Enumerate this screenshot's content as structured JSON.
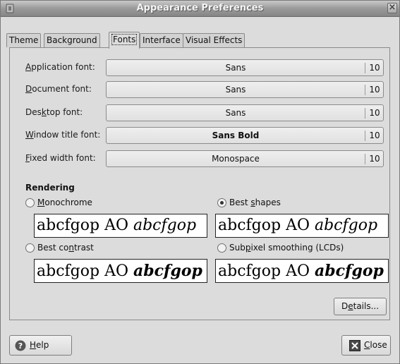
{
  "window": {
    "title": "Appearance Preferences",
    "close_glyph": "×"
  },
  "tabs": [
    {
      "label": "Theme",
      "active": false
    },
    {
      "label": "Background",
      "active": false
    },
    {
      "label": "Fonts",
      "active": true
    },
    {
      "label": "Interface",
      "active": false
    },
    {
      "label": "Visual Effects",
      "active": false
    }
  ],
  "fonts": [
    {
      "label": "Application font:",
      "mnemonic": "A",
      "font": "Sans",
      "size": "10"
    },
    {
      "label": "Document font:",
      "mnemonic": "D",
      "font": "Sans",
      "size": "10"
    },
    {
      "label": "Desktop font:",
      "mnemonic": "k",
      "font": "Sans",
      "size": "10"
    },
    {
      "label": "Window title font:",
      "mnemonic": "W",
      "font": "Sans Bold",
      "size": "10"
    },
    {
      "label": "Fixed width font:",
      "mnemonic": "F",
      "font": "Monospace",
      "size": "10"
    }
  ],
  "rendering": {
    "title": "Rendering",
    "options": [
      {
        "label": "Monochrome",
        "selected": false,
        "sample": {
          "plain": "abcfgop AO ",
          "styled": "abcfgop"
        }
      },
      {
        "label": "Best shapes",
        "selected": true,
        "sample": {
          "plain": "abcfgop AO ",
          "styled": "abcfgop"
        }
      },
      {
        "label": "Best contrast",
        "selected": false,
        "sample": {
          "plain": "abcfgop AO ",
          "styled": "abcfgop"
        }
      },
      {
        "label": "Subpixel smoothing (LCDs)",
        "selected": false,
        "sample": {
          "plain": "abcfgop AO ",
          "styled": "abcfgop"
        }
      }
    ]
  },
  "buttons": {
    "details": "Details...",
    "help": "Help",
    "close": "Close"
  },
  "colors": {
    "help_icon": "#555555",
    "close_icon": "#4a4a4a"
  }
}
